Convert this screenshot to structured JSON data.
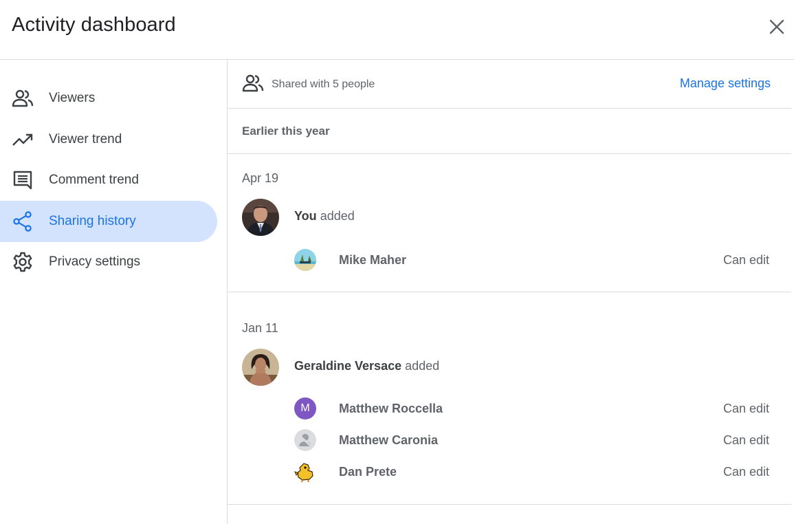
{
  "header": {
    "title": "Activity dashboard",
    "close_icon": "close-icon"
  },
  "sidebar": {
    "items": [
      {
        "label": "Viewers",
        "icon": "people-icon",
        "active": false
      },
      {
        "label": "Viewer trend",
        "icon": "trending-up-icon",
        "active": false
      },
      {
        "label": "Comment trend",
        "icon": "comment-icon",
        "active": false
      },
      {
        "label": "Sharing history",
        "icon": "share-icon",
        "active": true
      },
      {
        "label": "Privacy settings",
        "icon": "gear-icon",
        "active": false
      }
    ]
  },
  "main": {
    "shared_text": "Shared with 5 people",
    "manage_label": "Manage settings",
    "period_label": "Earlier this year",
    "groups": [
      {
        "date": "Apr 19",
        "actor": "You",
        "action": "added",
        "people": [
          {
            "name": "Mike Maher",
            "role": "Can edit"
          }
        ]
      },
      {
        "date": "Jan 11",
        "actor": "Geraldine Versace",
        "action": "added",
        "people": [
          {
            "name": "Matthew Roccella",
            "role": "Can edit",
            "initial": "M"
          },
          {
            "name": "Matthew Caronia",
            "role": "Can edit"
          },
          {
            "name": "Dan Prete",
            "role": "Can edit"
          }
        ]
      }
    ]
  },
  "colors": {
    "accent": "#1a73e8",
    "active_bg": "#d3e3fd",
    "divider": "#dadce0",
    "text_secondary": "#5f6368"
  }
}
